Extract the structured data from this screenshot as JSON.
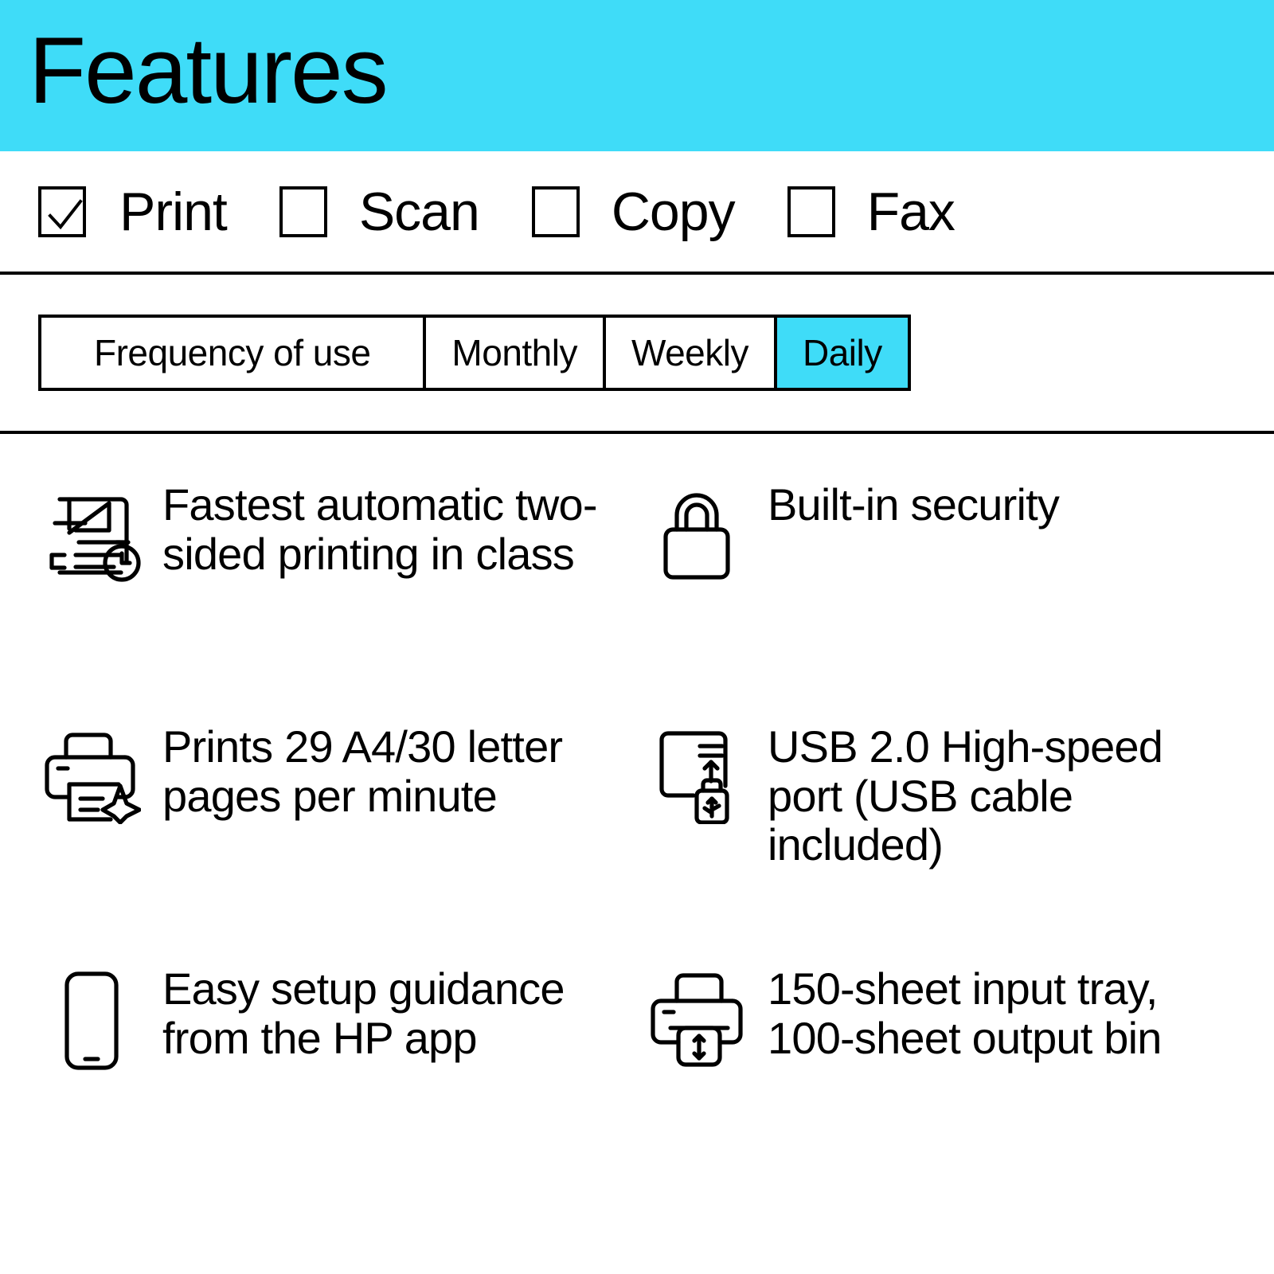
{
  "header": {
    "title": "Features",
    "band_color": "#3FDCF8"
  },
  "capabilities": {
    "items": [
      {
        "label": "Print",
        "checked": true,
        "icon": "checkbox-checked-icon"
      },
      {
        "label": "Scan",
        "checked": false,
        "icon": "checkbox-unchecked-icon"
      },
      {
        "label": "Copy",
        "checked": false,
        "icon": "checkbox-unchecked-icon"
      },
      {
        "label": "Fax",
        "checked": false,
        "icon": "checkbox-unchecked-icon"
      }
    ]
  },
  "frequency": {
    "label": "Frequency of use",
    "options": [
      {
        "label": "Monthly",
        "selected": false
      },
      {
        "label": "Weekly",
        "selected": false
      },
      {
        "label": "Daily",
        "selected": true
      }
    ],
    "selected": "Daily",
    "selected_color": "#3FDCF8"
  },
  "features": [
    {
      "icon": "fast-duplex-print-icon",
      "text": "Fastest automatic two-sided printing in class"
    },
    {
      "icon": "padlock-icon",
      "text": "Built-in security"
    },
    {
      "icon": "printer-sparkle-icon",
      "text": "Prints 29 A4/30 letter pages per minute"
    },
    {
      "icon": "usb-port-icon",
      "text": "USB 2.0 High-speed port (USB cable included)"
    },
    {
      "icon": "smartphone-icon",
      "text": "Easy setup guidance from the HP app"
    },
    {
      "icon": "paper-tray-capacity-icon",
      "text": "150-sheet input tray, 100-sheet output bin"
    }
  ]
}
